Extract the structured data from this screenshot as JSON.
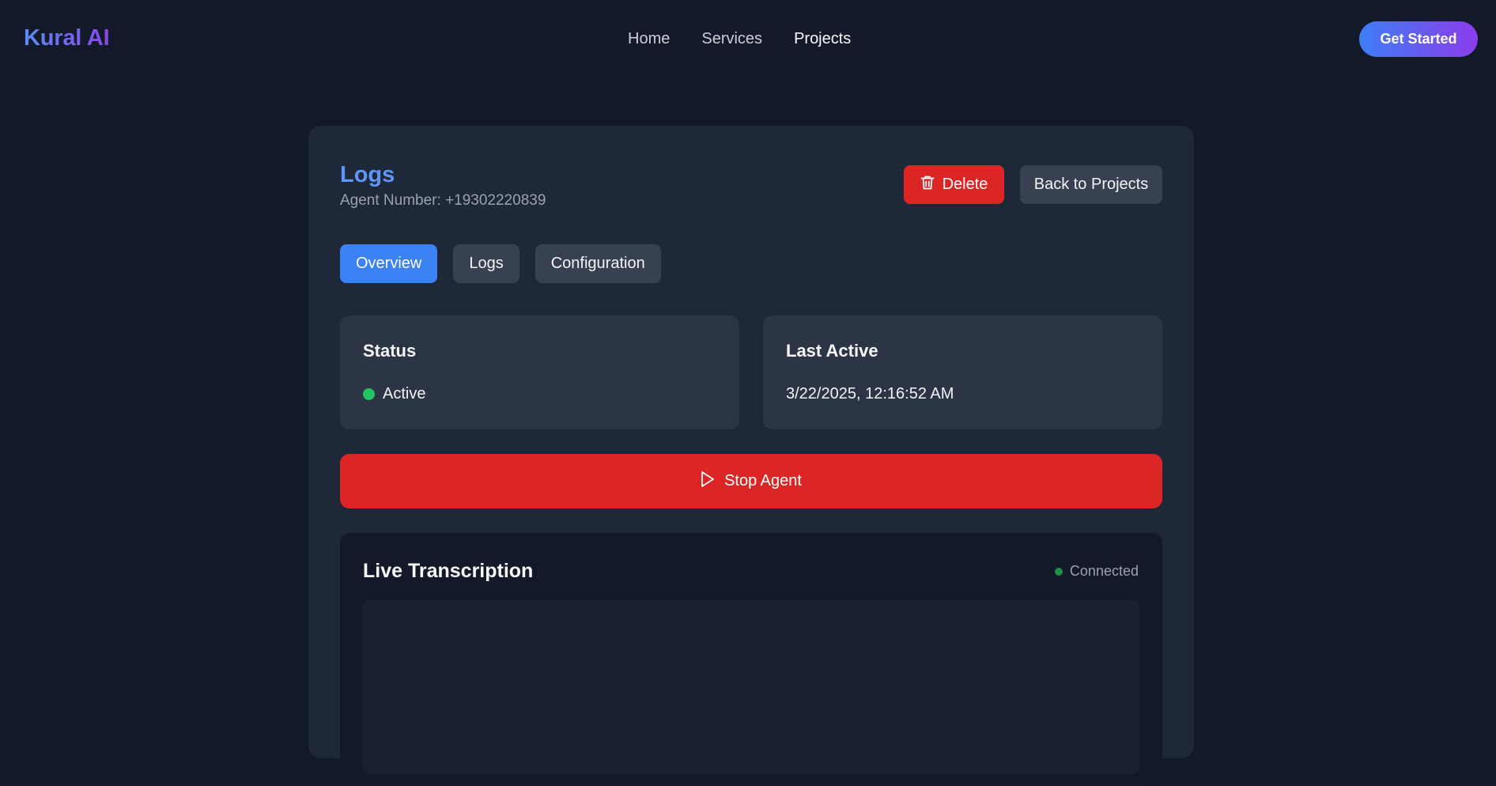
{
  "brand": "Kural AI",
  "nav": {
    "links": [
      "Home",
      "Services",
      "Projects"
    ],
    "active": "Projects",
    "cta": "Get Started"
  },
  "page": {
    "title": "Logs",
    "subtitle": "Agent Number: +19302220839",
    "delete_label": "Delete",
    "back_label": "Back to Projects"
  },
  "tabs": [
    {
      "label": "Overview",
      "active": true
    },
    {
      "label": "Logs",
      "active": false
    },
    {
      "label": "Configuration",
      "active": false
    }
  ],
  "status": {
    "label": "Status",
    "value": "Active",
    "color": "#22c55e"
  },
  "last_active": {
    "label": "Last Active",
    "value": "3/22/2025, 12:16:52 AM"
  },
  "stop_agent_label": "Stop Agent",
  "live": {
    "title": "Live Transcription",
    "connection": "Connected"
  },
  "icons": {
    "delete": "trash-icon",
    "stop": "play-triangle-icon"
  },
  "colors": {
    "accent": "#3b82f6",
    "danger": "#dc2626",
    "background": "#121a2a",
    "card": "#1f2839"
  }
}
